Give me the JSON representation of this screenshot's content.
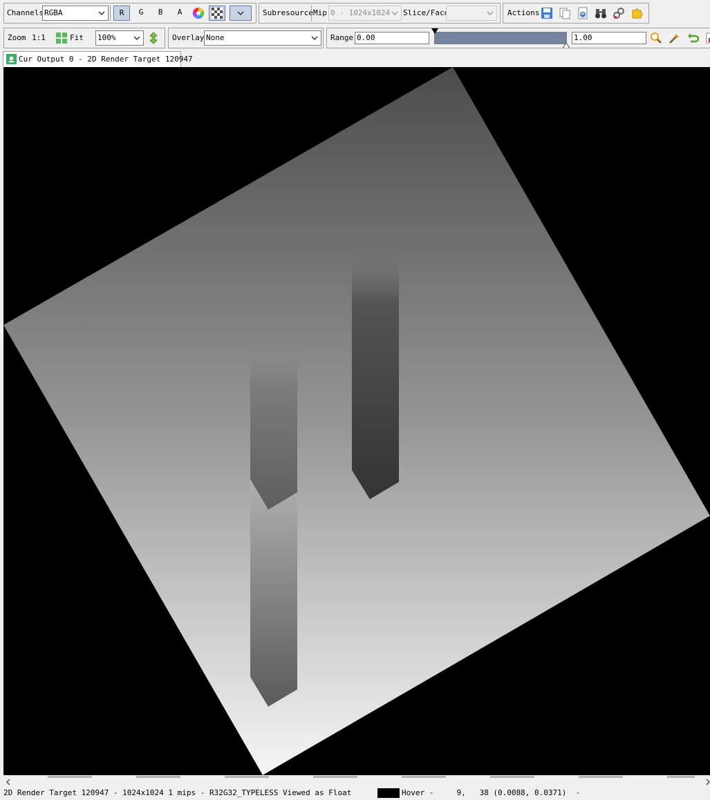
{
  "toolbar1": {
    "channels_label": "Channels",
    "channels_value": "RGBA",
    "r_label": "R",
    "g_label": "G",
    "b_label": "B",
    "a_label": "A",
    "subresource_label": "Subresource",
    "mip_label": "Mip",
    "mip_value": "0 - 1024x1024",
    "slice_label": "Slice/Face",
    "slice_value": "",
    "actions_label": "Actions"
  },
  "toolbar2": {
    "zoom_label": "Zoom",
    "zoom_1to1": "1:1",
    "fit_label": "Fit",
    "zoom_value": "100%",
    "overlay_label": "Overlay",
    "overlay_value": "None",
    "range_label": "Range",
    "range_min": "0.00",
    "range_max": "1.00"
  },
  "tab": {
    "title": "Cur Output 0 - 2D Render Target 120947"
  },
  "status": {
    "info": "2D Render Target 120947 - 1024x1024 1 mips - R32G32_TYPELESS Viewed as Float",
    "hover": "Hover -     9,   38 (0.0088, 0.0371)  -"
  },
  "colors": {
    "chrome": "#f0f0f0",
    "viewport_bg": "#000000",
    "toggle_on": "#c8d3e4",
    "range_bar": "#7383a0"
  }
}
